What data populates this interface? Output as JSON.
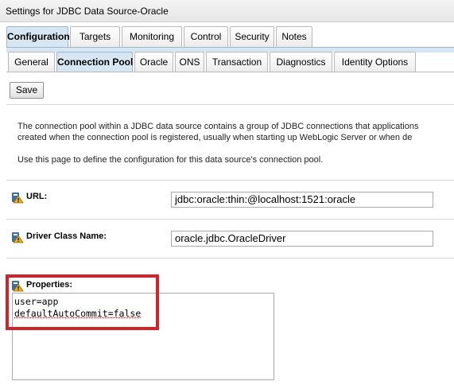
{
  "window": {
    "title": "Settings for JDBC Data Source-Oracle"
  },
  "tabs_primary": [
    {
      "label": "Configuration",
      "active": true
    },
    {
      "label": "Targets",
      "active": false
    },
    {
      "label": "Monitoring",
      "active": false
    },
    {
      "label": "Control",
      "active": false
    },
    {
      "label": "Security",
      "active": false
    },
    {
      "label": "Notes",
      "active": false
    }
  ],
  "tabs_secondary": [
    {
      "label": "General",
      "active": false
    },
    {
      "label": "Connection Pool",
      "active": true
    },
    {
      "label": "Oracle",
      "active": false
    },
    {
      "label": "ONS",
      "active": false
    },
    {
      "label": "Transaction",
      "active": false
    },
    {
      "label": "Diagnostics",
      "active": false
    },
    {
      "label": "Identity Options",
      "active": false
    }
  ],
  "toolbar": {
    "save_label": "Save"
  },
  "description": {
    "line1": "The connection pool within a JDBC data source contains a group of JDBC connections that applications",
    "line2": "created when the connection pool is registered, usually when starting up WebLogic Server or when de",
    "line3": "Use this page to define the configuration for this data source's connection pool."
  },
  "fields": {
    "url": {
      "label": "URL:",
      "value": "jdbc:oracle:thin:@localhost:1521:oracle"
    },
    "driver_class_name": {
      "label": "Driver Class Name:",
      "value": "oracle.jdbc.OracleDriver"
    },
    "properties": {
      "label": "Properties:",
      "lines": [
        "user=app",
        "defaultAutoCommit=false"
      ]
    }
  },
  "icons": {
    "field_help": "warning-key-icon"
  },
  "colors": {
    "active_tab": "#d6e6f3",
    "highlight": "#d0232a",
    "icon_gold": "#e8b020",
    "icon_blue": "#3a6ea5"
  }
}
